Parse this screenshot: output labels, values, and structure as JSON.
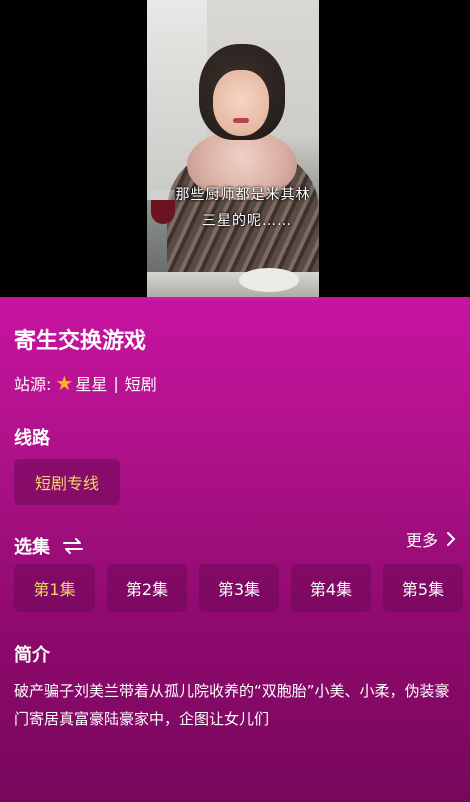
{
  "player": {
    "subtitle_line1": "那些厨师都是米其林",
    "subtitle_line2": "三星的呢……"
  },
  "drama": {
    "title": "寄生交换游戏",
    "source_label": "站源:",
    "source_name": "星星",
    "source_sep": "|",
    "source_type": "短剧"
  },
  "route": {
    "heading": "线路",
    "options": [
      "短剧专线"
    ],
    "selected": "短剧专线"
  },
  "episodes": {
    "heading": "选集",
    "more_label": "更多",
    "items": [
      "第1集",
      "第2集",
      "第3集",
      "第4集",
      "第5集"
    ],
    "selected": "第1集"
  },
  "intro": {
    "heading": "简介",
    "text": "破产骗子刘美兰带着从孤儿院收养的“双胞胎”小美、小柔，伪装豪门寄居真富豪陆豪家中，企图让女儿们"
  },
  "colors": {
    "accent": "#f5d46a",
    "star": "#ffb21a",
    "panel_top": "#d214aa",
    "panel_bottom": "#78085c"
  },
  "icons": {
    "source": "star-icon",
    "episodes_order": "swap-icon",
    "more": "chevron-right-icon"
  }
}
